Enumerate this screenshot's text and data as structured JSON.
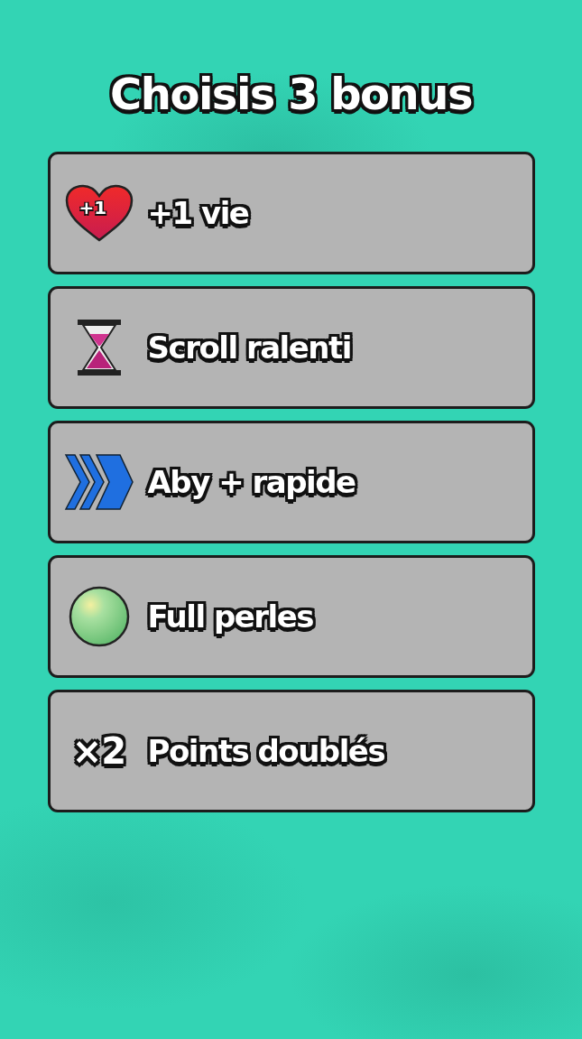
{
  "title": "Choisis 3 bonus",
  "bonuses": [
    {
      "kind": "heart",
      "badge": "+1",
      "label": "+1 vie"
    },
    {
      "kind": "hourglass",
      "label": "Scroll ralenti"
    },
    {
      "kind": "chevrons",
      "label": "Aby + rapide"
    },
    {
      "kind": "pearl",
      "label": "Full perles"
    },
    {
      "kind": "multiplier",
      "badge": "×2",
      "label": "Points doublés"
    }
  ]
}
